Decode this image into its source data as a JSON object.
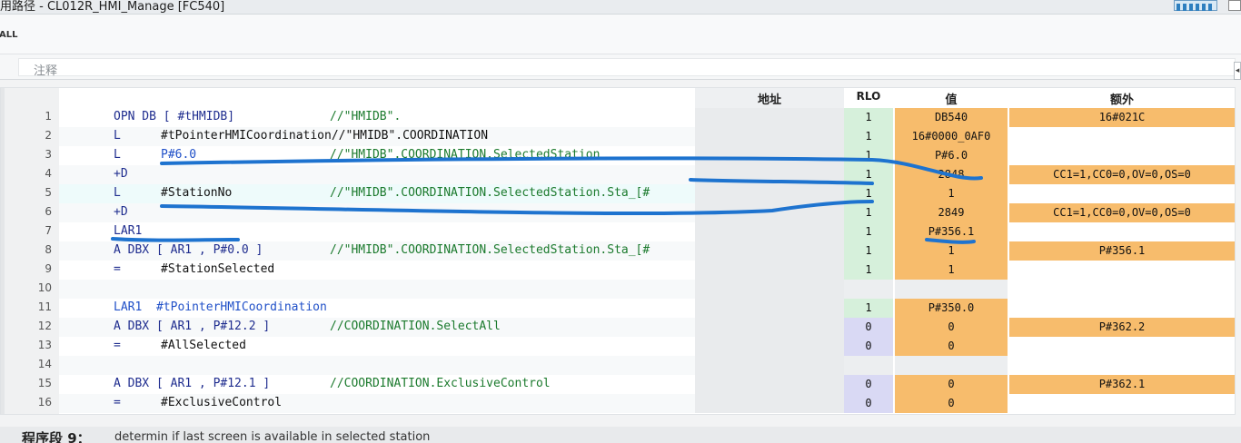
{
  "window": {
    "title": "用路径 - CL012R_HMI_Manage [FC540]"
  },
  "toolbar": {
    "all_label": "ALL"
  },
  "block_comment": {
    "label": "注释"
  },
  "columns": {
    "address": "地址",
    "rlo": "RLO",
    "value": "值",
    "extra": "额外"
  },
  "rows": [
    {
      "no": "1",
      "instr": "OPN DB [ #tHMIDB]",
      "operand": "",
      "comment": "//\"HMIDB\".",
      "rlo": "1",
      "value": "DB540",
      "extra": "16#021C",
      "rlo_style": "g",
      "value_style": "o",
      "extra_style": "o"
    },
    {
      "no": "2",
      "instr": "L",
      "operand": "#tPointerHMICoordination//\"HMIDB\".COORDINATION",
      "comment": "",
      "rlo": "1",
      "value": "16#0000_0AF0",
      "extra": "",
      "rlo_style": "g",
      "value_style": "o",
      "extra_style": "e"
    },
    {
      "no": "3",
      "instr": "L",
      "operand": "P#6.0",
      "comment": "//\"HMIDB\".COORDINATION.SelectedStation",
      "rlo": "1",
      "value": "P#6.0",
      "extra": "",
      "rlo_style": "g",
      "value_style": "o",
      "extra_style": "e"
    },
    {
      "no": "4",
      "instr": "+D",
      "operand": "",
      "comment": "",
      "rlo": "1",
      "value": "2848",
      "extra": "CC1=1,CC0=0,OV=0,OS=0",
      "rlo_style": "g",
      "value_style": "o",
      "extra_style": "o"
    },
    {
      "no": "5",
      "instr": "L",
      "operand": "#StationNo",
      "comment": "//\"HMIDB\".COORDINATION.SelectedStation.Sta_[#",
      "rlo": "1",
      "value": "1",
      "extra": "",
      "rlo_style": "g",
      "value_style": "o",
      "extra_style": "e"
    },
    {
      "no": "6",
      "instr": "+D",
      "operand": "",
      "comment": "",
      "rlo": "1",
      "value": "2849",
      "extra": "CC1=1,CC0=0,OV=0,OS=0",
      "rlo_style": "g",
      "value_style": "o",
      "extra_style": "o"
    },
    {
      "no": "7",
      "instr": "LAR1",
      "operand": "",
      "comment": "",
      "rlo": "1",
      "value": "P#356.1",
      "extra": "",
      "rlo_style": "g",
      "value_style": "o",
      "extra_style": "e"
    },
    {
      "no": "8",
      "instr": "A DBX [ AR1 , P#0.0 ]",
      "operand": "",
      "comment": "//\"HMIDB\".COORDINATION.SelectedStation.Sta_[#",
      "rlo": "1",
      "value": "1",
      "extra": "P#356.1",
      "rlo_style": "g",
      "value_style": "o",
      "extra_style": "o"
    },
    {
      "no": "9",
      "instr": "=",
      "operand": "#StationSelected",
      "comment": "",
      "rlo": "1",
      "value": "1",
      "extra": "",
      "rlo_style": "g",
      "value_style": "o",
      "extra_style": "e"
    },
    {
      "no": "10",
      "instr": "",
      "operand": "",
      "comment": "",
      "rlo": "",
      "value": "",
      "extra": "",
      "rlo_style": "e",
      "value_style": "e",
      "extra_style": "e"
    },
    {
      "no": "11",
      "instr": "LAR1  #tPointerHMICoordination",
      "operand": "",
      "comment": "",
      "rlo": "1",
      "value": "P#350.0",
      "extra": "",
      "rlo_style": "g",
      "value_style": "o",
      "extra_style": "e"
    },
    {
      "no": "12",
      "instr": "A DBX [ AR1 , P#12.2 ]",
      "operand": "",
      "comment": "//COORDINATION.SelectAll",
      "rlo": "0",
      "value": "0",
      "extra": "P#362.2",
      "rlo_style": "b",
      "value_style": "o",
      "extra_style": "o"
    },
    {
      "no": "13",
      "instr": "=",
      "operand": "#AllSelected",
      "comment": "",
      "rlo": "0",
      "value": "0",
      "extra": "",
      "rlo_style": "b",
      "value_style": "o",
      "extra_style": "e"
    },
    {
      "no": "14",
      "instr": "",
      "operand": "",
      "comment": "",
      "rlo": "",
      "value": "",
      "extra": "",
      "rlo_style": "e",
      "value_style": "e",
      "extra_style": "e"
    },
    {
      "no": "15",
      "instr": "A DBX [ AR1 , P#12.1 ]",
      "operand": "",
      "comment": "//COORDINATION.ExclusiveControl",
      "rlo": "0",
      "value": "0",
      "extra": "P#362.1",
      "rlo_style": "b",
      "value_style": "o",
      "extra_style": "o"
    },
    {
      "no": "16",
      "instr": "=",
      "operand": "#ExclusiveControl",
      "comment": "",
      "rlo": "0",
      "value": "0",
      "extra": "",
      "rlo_style": "b",
      "value_style": "o",
      "extra_style": "e"
    }
  ],
  "network": {
    "title": "程序段 9：",
    "comment": "determin if last screen is available in selected station"
  }
}
